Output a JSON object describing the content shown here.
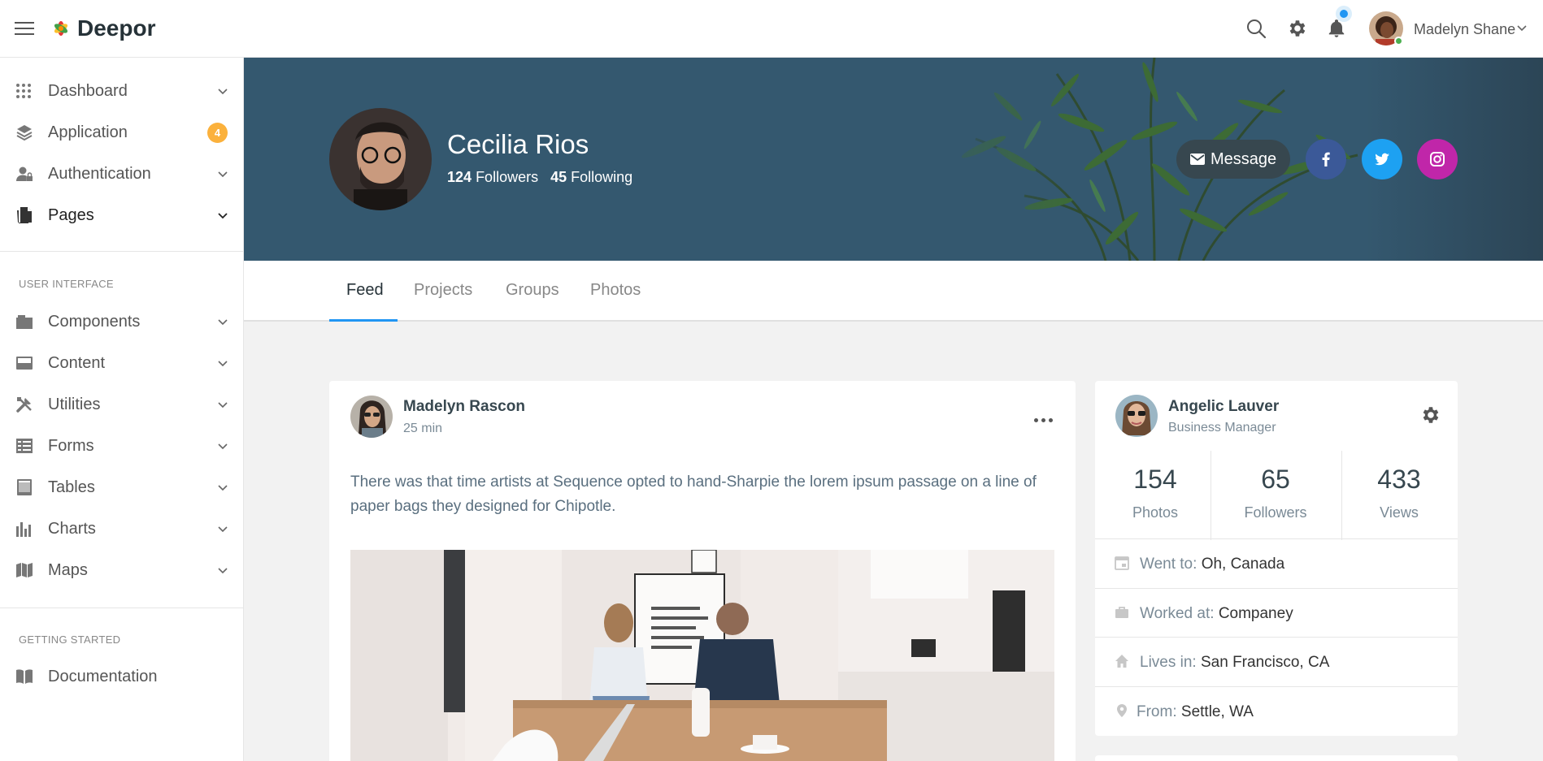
{
  "header": {
    "brand": "Deepor",
    "user_name": "Madelyn Shane",
    "icons": [
      "hamburger-icon",
      "search-icon",
      "gear-icon",
      "bell-icon"
    ]
  },
  "sidebar": {
    "items": [
      {
        "label": "Dashboard",
        "icon": "grid-dots-icon"
      },
      {
        "label": "Application",
        "icon": "layers-icon",
        "badge": "4"
      },
      {
        "label": "Authentication",
        "icon": "user-lock-icon"
      },
      {
        "label": "Pages",
        "icon": "pages-icon"
      }
    ],
    "section_ui": "USER INTERFACE",
    "ui_items": [
      {
        "label": "Components",
        "icon": "components-icon"
      },
      {
        "label": "Content",
        "icon": "content-icon"
      },
      {
        "label": "Utilities",
        "icon": "tools-icon"
      },
      {
        "label": "Forms",
        "icon": "forms-icon"
      },
      {
        "label": "Tables",
        "icon": "table-icon"
      },
      {
        "label": "Charts",
        "icon": "bar-chart-icon"
      },
      {
        "label": "Maps",
        "icon": "map-icon"
      }
    ],
    "section_start": "GETTING STARTED",
    "start_items": [
      {
        "label": "Documentation",
        "icon": "book-icon"
      }
    ]
  },
  "profile": {
    "name": "Cecilia Rios",
    "followers_count": "124",
    "followers_label": "Followers",
    "following_count": "45",
    "following_label": "Following",
    "message_label": "Message",
    "socials": [
      {
        "name": "facebook",
        "color": "#3b5998"
      },
      {
        "name": "twitter",
        "color": "#1da1f2"
      },
      {
        "name": "instagram",
        "color": "#c026a9"
      }
    ]
  },
  "tabs": [
    "Feed",
    "Projects",
    "Groups",
    "Photos"
  ],
  "post": {
    "author": "Madelyn Rascon",
    "time": "25 min",
    "text": "There was that time artists at Sequence opted to hand-Sharpie the lorem ipsum passage on a line of paper bags they designed for Chipotle."
  },
  "about": {
    "name": "Angelic Lauver",
    "role": "Business Manager",
    "stats": [
      {
        "value": "154",
        "label": "Photos"
      },
      {
        "value": "65",
        "label": "Followers"
      },
      {
        "value": "433",
        "label": "Views"
      }
    ],
    "info": [
      {
        "key": "Went to:",
        "value": "Oh, Canada",
        "icon": "calendar-icon"
      },
      {
        "key": "Worked at:",
        "value": "Companey",
        "icon": "briefcase-icon"
      },
      {
        "key": "Lives in:",
        "value": "San Francisco, CA",
        "icon": "home-icon"
      },
      {
        "key": "From:",
        "value": "Settle, WA",
        "icon": "map-pin-icon"
      }
    ]
  },
  "colors": {
    "accent": "#2196f3",
    "cover": "#34586f",
    "badge": "#fbb13c"
  }
}
